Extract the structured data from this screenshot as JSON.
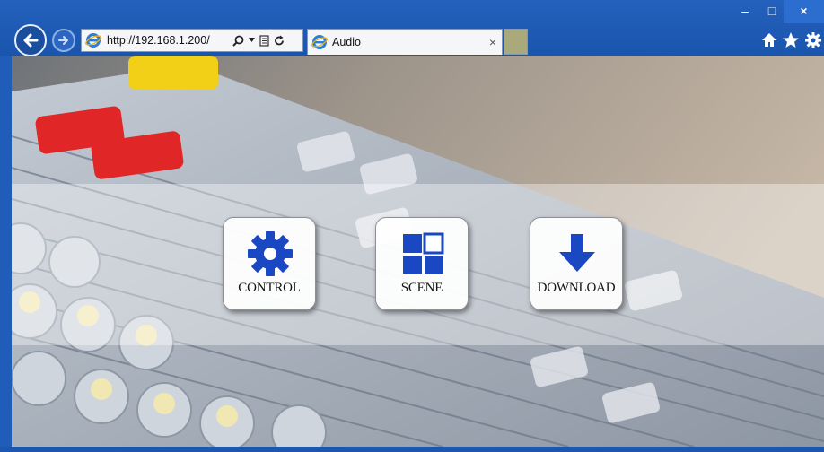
{
  "browser": {
    "address_url": "http://192.168.1.200/",
    "tab_title": "Audio",
    "tab_close": "×",
    "window_controls": {
      "minimize": "–",
      "maximize": "□",
      "close": "×"
    },
    "icons": [
      "back-arrow-icon",
      "forward-arrow-icon",
      "ie-logo-icon",
      "search-icon",
      "dropdown-arrow-icon",
      "compatibility-icon",
      "refresh-icon",
      "close-icon",
      "home-icon",
      "favorites-star-icon",
      "settings-gear-icon"
    ]
  },
  "page": {
    "background": "audio mixing console photo",
    "tiles": [
      {
        "label": "CONTROL",
        "icon": "gear-icon",
        "color": "#1a47c2"
      },
      {
        "label": "SCENE",
        "icon": "grid-scene-icon",
        "color": "#1a47c2"
      },
      {
        "label": "DOWNLOAD",
        "icon": "download-arrow-icon",
        "color": "#1a47c2"
      }
    ]
  }
}
